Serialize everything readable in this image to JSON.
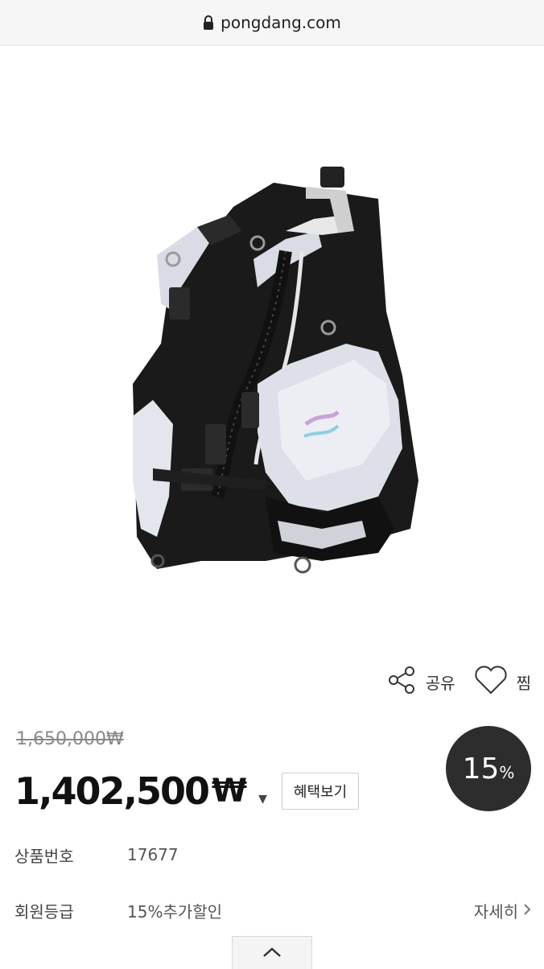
{
  "browser": {
    "url": "pongdang.com"
  },
  "product": {
    "image_alt": "BCD vest",
    "original_price": "1,650,000₩",
    "sale_price": "1,402,500",
    "currency": "₩",
    "discount_number": "15",
    "discount_unit": "%"
  },
  "actions": {
    "share_label": "공유",
    "wish_label": "찜"
  },
  "benefit_button_label": "혜택보기",
  "info": {
    "product_no_label": "상품번호",
    "product_no_value": "17677",
    "member_grade_label": "회원등급",
    "member_grade_value": "15%추가할인",
    "detail_link_label": "자세히"
  },
  "icons": {
    "lock": "lock-icon",
    "share": "share-icon",
    "heart": "heart-icon",
    "caret": "caret-down-icon",
    "chevron_right": "chevron-right-icon",
    "chevron_up": "chevron-up-icon"
  },
  "colors": {
    "badge_bg": "#2d2d2d",
    "vest_black": "#1a1a1a",
    "vest_gray": "#dcdfe6"
  }
}
